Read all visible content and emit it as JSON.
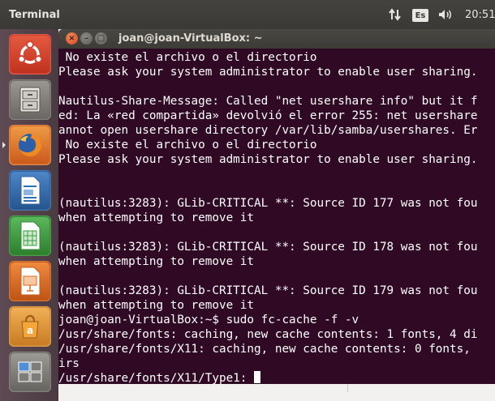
{
  "panel": {
    "app_title": "Terminal",
    "language": "Es",
    "clock": "20:51",
    "network_icon": "network-updown-icon",
    "volume_icon": "volume-icon"
  },
  "launcher": {
    "items": [
      {
        "name": "ubuntu-dash",
        "icon": "ubuntu-logo-icon",
        "color": "#d8412f"
      },
      {
        "name": "files",
        "icon": "file-cabinet-icon",
        "color": "#7a7774"
      },
      {
        "name": "firefox",
        "icon": "firefox-icon",
        "color": "#e8782a"
      },
      {
        "name": "libreoffice-writer",
        "icon": "writer-document-icon",
        "color": "#2f6fb5"
      },
      {
        "name": "libreoffice-calc",
        "icon": "calc-spreadsheet-icon",
        "color": "#3a9e3a"
      },
      {
        "name": "libreoffice-impress",
        "icon": "impress-presentation-icon",
        "color": "#d96a1e"
      },
      {
        "name": "software-center",
        "icon": "software-center-icon",
        "color": "#e89a3c"
      },
      {
        "name": "workspace-switcher",
        "icon": "workspace-icon",
        "color": "#7f7d78"
      }
    ]
  },
  "window": {
    "title": "joan@joan-VirtualBox: ~",
    "close_glyph": "×",
    "minimize_glyph": "–",
    "maximize_glyph": "□",
    "background": "#300a24"
  },
  "terminal": {
    "lines": [
      " No existe el archivo o el directorio",
      "Please ask your system administrator to enable user sharing.",
      "",
      "Nautilus-Share-Message: Called \"net usershare info\" but it f",
      "ed: La «red compartida» devolvió el error 255: net usershare",
      "annot open usershare directory /var/lib/samba/usershares. Er",
      " No existe el archivo o el directorio",
      "Please ask your system administrator to enable user sharing.",
      "",
      "",
      "(nautilus:3283): GLib-CRITICAL **: Source ID 177 was not fou",
      "when attempting to remove it",
      "",
      "(nautilus:3283): GLib-CRITICAL **: Source ID 178 was not fou",
      "when attempting to remove it",
      "",
      "(nautilus:3283): GLib-CRITICAL **: Source ID 179 was not fou",
      "when attempting to remove it",
      "joan@joan-VirtualBox:~$ sudo fc-cache -f -v",
      "/usr/share/fonts: caching, new cache contents: 1 fonts, 4 di",
      "/usr/share/fonts/X11: caching, new cache contents: 0 fonts, ",
      "irs",
      "/usr/share/fonts/X11/Type1: "
    ]
  }
}
